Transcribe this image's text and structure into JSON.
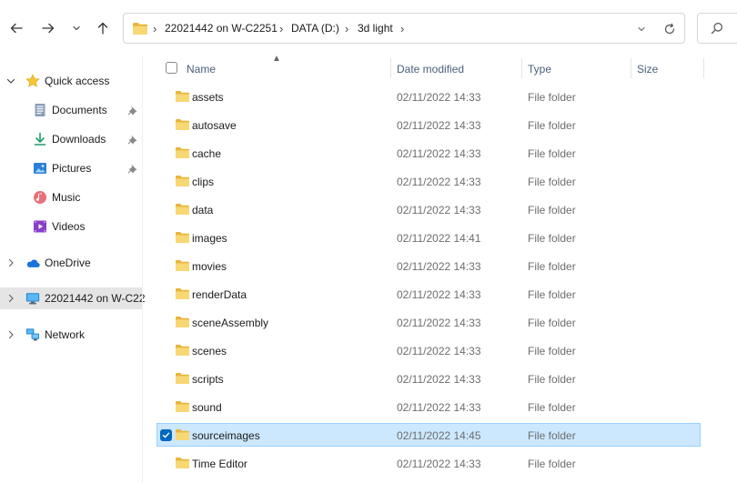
{
  "toolbar": {
    "back_icon": "arrow-left-icon",
    "forward_icon": "arrow-right-icon",
    "recent_icon": "chevron-down-icon",
    "up_icon": "arrow-up-icon"
  },
  "address": {
    "crumbs": [
      "22021442 on W-C2251",
      "DATA (D:)",
      "3d light"
    ],
    "separator": "›"
  },
  "search": {
    "icon": "search-icon"
  },
  "nav": {
    "items": [
      {
        "label": "Quick access",
        "icon": "star-icon",
        "expanded": true
      },
      {
        "label": "Documents",
        "icon": "documents-icon",
        "pinned": true
      },
      {
        "label": "Downloads",
        "icon": "download-icon",
        "pinned": true
      },
      {
        "label": "Pictures",
        "icon": "pictures-icon",
        "pinned": true
      },
      {
        "label": "Music",
        "icon": "music-icon"
      },
      {
        "label": "Videos",
        "icon": "videos-icon"
      },
      {
        "label": "OneDrive",
        "icon": "cloud-icon"
      },
      {
        "label": "22021442 on W-C22",
        "icon": "computer-icon",
        "selected": true
      },
      {
        "label": "Network",
        "icon": "network-icon"
      }
    ]
  },
  "list": {
    "columns": {
      "name": "Name",
      "date": "Date modified",
      "type": "Type",
      "size": "Size"
    },
    "rows": [
      {
        "name": "assets",
        "date": "02/11/2022 14:33",
        "type": "File folder"
      },
      {
        "name": "autosave",
        "date": "02/11/2022 14:33",
        "type": "File folder"
      },
      {
        "name": "cache",
        "date": "02/11/2022 14:33",
        "type": "File folder"
      },
      {
        "name": "clips",
        "date": "02/11/2022 14:33",
        "type": "File folder"
      },
      {
        "name": "data",
        "date": "02/11/2022 14:33",
        "type": "File folder"
      },
      {
        "name": "images",
        "date": "02/11/2022 14:41",
        "type": "File folder"
      },
      {
        "name": "movies",
        "date": "02/11/2022 14:33",
        "type": "File folder"
      },
      {
        "name": "renderData",
        "date": "02/11/2022 14:33",
        "type": "File folder"
      },
      {
        "name": "sceneAssembly",
        "date": "02/11/2022 14:33",
        "type": "File folder"
      },
      {
        "name": "scenes",
        "date": "02/11/2022 14:33",
        "type": "File folder"
      },
      {
        "name": "scripts",
        "date": "02/11/2022 14:33",
        "type": "File folder"
      },
      {
        "name": "sound",
        "date": "02/11/2022 14:33",
        "type": "File folder"
      },
      {
        "name": "sourceimages",
        "date": "02/11/2022 14:45",
        "type": "File folder",
        "selected": true
      },
      {
        "name": "Time Editor",
        "date": "02/11/2022 14:33",
        "type": "File folder"
      }
    ]
  },
  "colors": {
    "accent": "#0067c0",
    "selection": "#cce8ff",
    "folder": "#f8d775"
  }
}
